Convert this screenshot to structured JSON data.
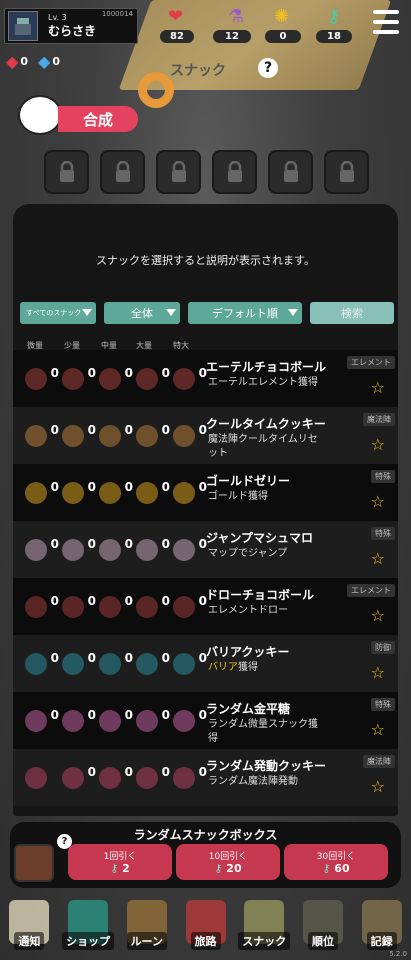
{
  "player": {
    "level": "Lv. 3",
    "name": "むらさき",
    "id": "1000014"
  },
  "stats": {
    "hearts": "82",
    "potions": "12",
    "coins": "0",
    "keys": "18"
  },
  "gems": {
    "red": "0",
    "blue": "0"
  },
  "scene": {
    "sign": "スナック",
    "help": "?",
    "craft_label": "合成"
  },
  "panel": {
    "description": "スナックを選択すると説明が表示されます。",
    "filters": {
      "type": "すべてのスナック",
      "scope": "全体",
      "sort": "デフォルト順",
      "search": "検索"
    },
    "columns": [
      "微量",
      "少量",
      "中量",
      "大量",
      "特大"
    ],
    "rows": [
      {
        "name": "エーテルチョコボール",
        "desc": "エーテルエレメント獲得",
        "tag": "エレメント",
        "counts": [
          "0",
          "0",
          "0",
          "0",
          "0"
        ],
        "color": "#a0403a"
      },
      {
        "name": "クールタイムクッキー",
        "desc": "魔法陣クールタイムリセット",
        "tag": "魔法陣",
        "counts": [
          "0",
          "0",
          "0",
          "0",
          "0"
        ],
        "color": "#b07a3a"
      },
      {
        "name": "ゴールドゼリー",
        "desc": "ゴールド獲得",
        "tag": "特殊",
        "counts": [
          "0",
          "0",
          "0",
          "0",
          "0"
        ],
        "color": "#d4a020"
      },
      {
        "name": "ジャンプマシュマロ",
        "desc": "マップでジャンプ",
        "tag": "特殊",
        "counts": [
          "0",
          "0",
          "0",
          "0",
          "0"
        ],
        "color": "#c0a0b0"
      },
      {
        "name": "ドローチョコボール",
        "desc": "エレメントドロー",
        "tag": "エレメント",
        "counts": [
          "0",
          "0",
          "0",
          "0",
          "0"
        ],
        "color": "#9a3a3a"
      },
      {
        "name": "バリアクッキー",
        "desc_prefix": "バリア",
        "desc": "獲得",
        "tag": "防御",
        "counts": [
          "0",
          "0",
          "0",
          "0",
          "0"
        ],
        "color": "#2a8a9a"
      },
      {
        "name": "ランダム金平糖",
        "desc": "ランダム微量スナック獲得",
        "tag": "特殊",
        "counts": [
          "0",
          "0",
          "0",
          "0",
          "0"
        ],
        "color": "#c060a0"
      },
      {
        "name": "ランダム発動クッキー",
        "desc": "ランダム魔法陣発動",
        "tag": "魔法陣",
        "counts": [
          "",
          "0",
          "0",
          "0",
          "0"
        ],
        "color": "#b04060"
      }
    ]
  },
  "snack_box": {
    "title": "ランダムスナックボックス",
    "help": "?",
    "options": [
      {
        "label": "1回引く",
        "cost": "2"
      },
      {
        "label": "10回引く",
        "cost": "20"
      },
      {
        "label": "30回引く",
        "cost": "60"
      }
    ]
  },
  "nav": {
    "items": [
      "通知",
      "ショップ",
      "ルーン",
      "旅路",
      "スナック",
      "順位",
      "記録"
    ],
    "version": "5.2.0"
  },
  "colors": {
    "accent": "#c63750",
    "filter": "#5da899",
    "star": "#f5c518"
  }
}
